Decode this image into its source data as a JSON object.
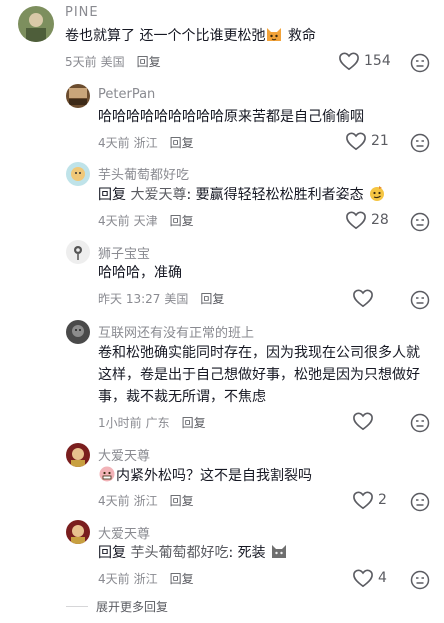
{
  "comments": [
    {
      "name": "PINE",
      "text": "卷也就算了 还一个个比谁更松弛",
      "text_suffix": " 救命",
      "time": "5天前",
      "location": "美国",
      "reply": "回复",
      "likes": "154"
    },
    {
      "name": "PeterPan",
      "text": "哈哈哈哈哈哈哈哈哈原来苦都是自己偷偷咽",
      "time": "4天前",
      "location": "浙江",
      "reply": "回复",
      "likes": "21"
    },
    {
      "name": "芋头葡萄都好吃",
      "reply_prefix": "回复",
      "reply_to": "大爱天尊",
      "text": ": 要赢得轻轻松松胜利者姿态",
      "time": "4天前",
      "location": "天津",
      "reply": "回复",
      "likes": "28"
    },
    {
      "name": "狮子宝宝",
      "text": "哈哈哈，准确",
      "time": "昨天 13:27",
      "location": "美国",
      "reply": "回复",
      "likes": ""
    },
    {
      "name": "互联网还有没有正常的班上",
      "text": "卷和松弛确实能同时存在，因为我现在公司很多人就这样，卷是出于自己想做好事，松弛是因为只想做好事，裁不裁无所谓，不焦虑",
      "time": "1小时前",
      "location": "广东",
      "reply": "回复",
      "likes": ""
    },
    {
      "name": "大爱天尊",
      "text": "内紧外松吗？这不是自我割裂吗",
      "time": "4天前",
      "location": "浙江",
      "reply": "回复",
      "likes": "2"
    },
    {
      "name": "大爱天尊",
      "reply_prefix": "回复",
      "reply_to": "芋头葡萄都好吃",
      "text": ": 死装",
      "time": "4天前",
      "location": "浙江",
      "reply": "回复",
      "likes": "4"
    }
  ],
  "expand_label": "展开更多回复",
  "icons": {
    "like": "heart-outline-icon",
    "dislike": "dislike-face-icon"
  }
}
